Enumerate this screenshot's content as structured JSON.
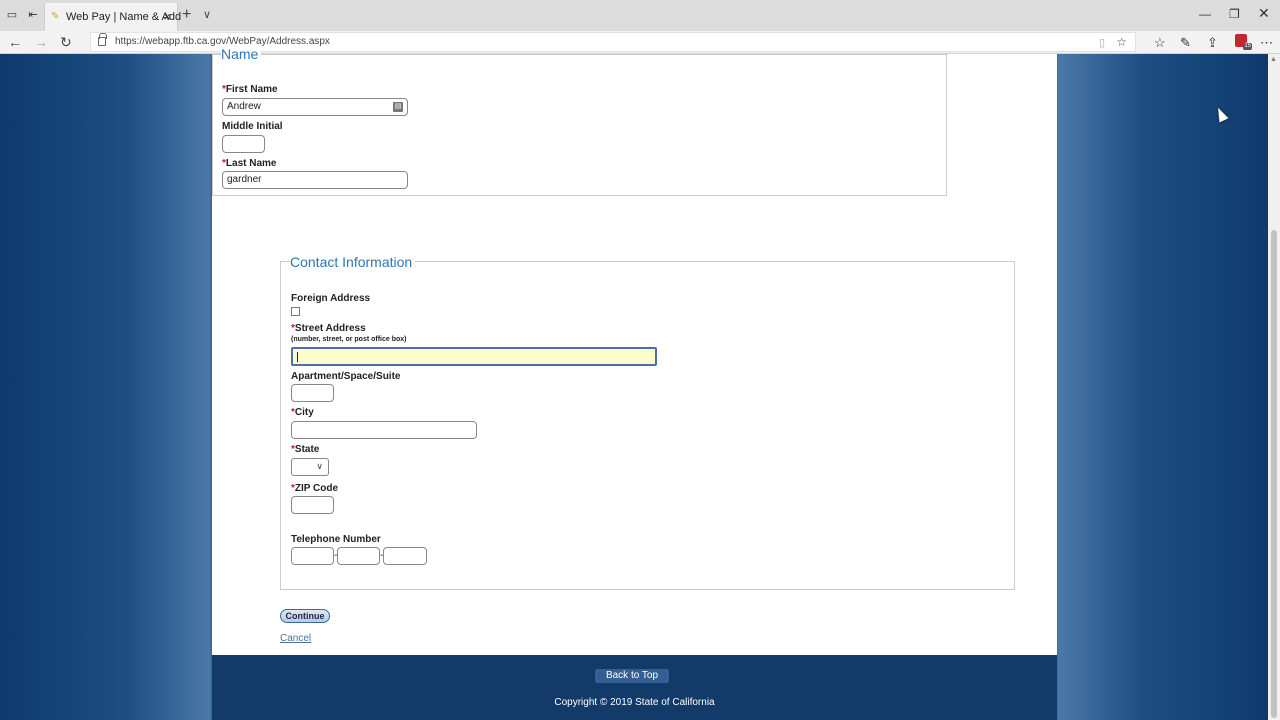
{
  "browser": {
    "tab_title": "Web Pay | Name & Add",
    "url": "https://webapp.ftb.ca.gov/WebPay/Address.aspx",
    "ext_badge": "15"
  },
  "name_section": {
    "legend": "Name",
    "first_name_label": "First Name",
    "first_name_value": "Andrew",
    "middle_initial_label": "Middle Initial",
    "middle_initial_value": "",
    "last_name_label": "Last Name",
    "last_name_value": "gardner",
    "required_mark": "*"
  },
  "contact_section": {
    "legend": "Contact Information",
    "foreign_address_label": "Foreign Address",
    "foreign_address_checked": false,
    "street_label": "Street Address",
    "street_hint": "(number, street, or post office box)",
    "street_value": "",
    "apt_label": "Apartment/Space/Suite",
    "city_label": "City",
    "state_label": "State",
    "state_value": "",
    "zip_label": "ZIP Code",
    "phone_label": "Telephone Number",
    "phone_separator": "-"
  },
  "actions": {
    "continue_label": "Continue",
    "cancel_label": "Cancel"
  },
  "footer": {
    "back_to_top": "Back to Top",
    "copyright": "Copyright © 2019 State of California"
  },
  "colors": {
    "legend": "#2c77b4",
    "required": "#c02020",
    "focus_bg": "#fdfccc",
    "footer_bg": "#123b6a"
  }
}
